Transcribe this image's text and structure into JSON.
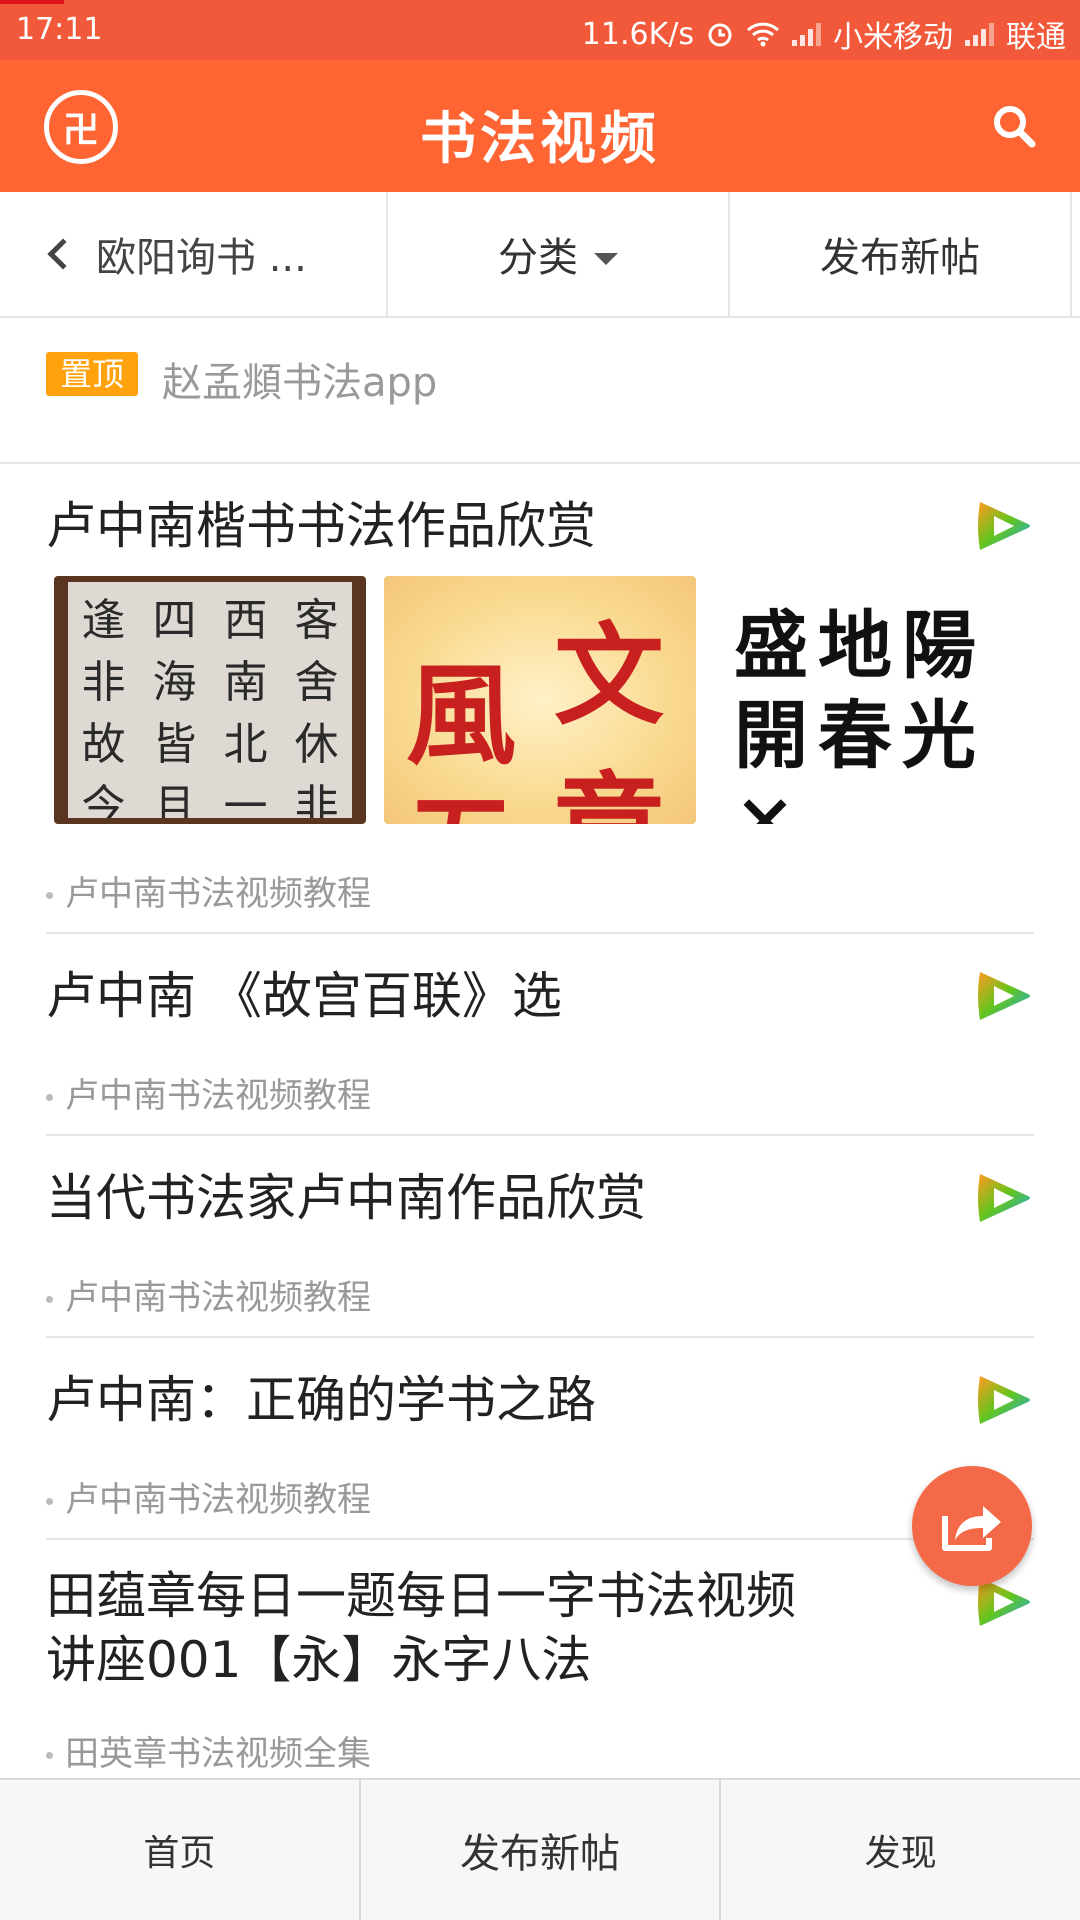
{
  "status_bar": {
    "time": "17:11",
    "net_speed": "11.6K/s",
    "carrier1": "小米移动",
    "carrier2": "联通"
  },
  "header": {
    "title": "书法视频",
    "logo_glyph": "卍"
  },
  "toolbar": {
    "back_label": "欧阳询书 ...",
    "category_label": "分类",
    "new_post_label": "发布新帖"
  },
  "pinned": {
    "badge": "置顶",
    "text": "赵孟頫书法app"
  },
  "posts": [
    {
      "title": "卢中南楷书书法作品欣赏",
      "meta": "卢中南书法视频教程",
      "thumbs": [
        {
          "chars": [
            "逢",
            "四",
            "西",
            "客",
            "非",
            "海",
            "南",
            "舍",
            "故",
            "皆",
            "北",
            "休",
            "今",
            "且",
            "一",
            "非"
          ]
        },
        {
          "chars": [
            "風",
            "文",
            "五",
            "章"
          ]
        },
        {
          "lines": [
            "盛地陽",
            "開春光",
            "  ×"
          ]
        }
      ]
    },
    {
      "title": "卢中南 《故宫百联》选",
      "meta": "卢中南书法视频教程"
    },
    {
      "title": "当代书法家卢中南作品欣赏",
      "meta": "卢中南书法视频教程"
    },
    {
      "title": "卢中南：正确的学书之路",
      "meta": "卢中南书法视频教程"
    },
    {
      "title_line1": "田蕴章每日一题每日一字书法视频",
      "title_line2": "讲座001【永】永字八法",
      "meta": "田英章书法视频全集"
    }
  ],
  "bottom_nav": {
    "home": "首页",
    "new_post": "发布新帖",
    "discover": "发现"
  },
  "colors": {
    "accent": "#ff6433",
    "status_bar": "#f1593a",
    "pin_badge": "#ffa20d"
  }
}
